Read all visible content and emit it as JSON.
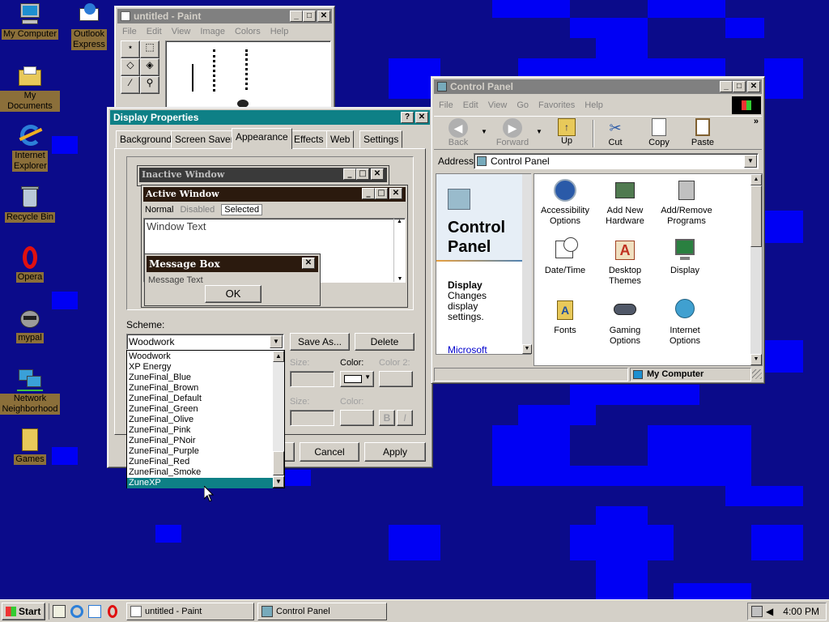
{
  "desktop": {
    "icons": [
      {
        "label": "My Computer"
      },
      {
        "label": "Outlook Express"
      },
      {
        "label": "My Documents"
      },
      {
        "label": "Internet Explorer"
      },
      {
        "label": "Recycle Bin"
      },
      {
        "label": "Opera"
      },
      {
        "label": "mypal"
      },
      {
        "label": "Network Neighborhood"
      },
      {
        "label": "Games"
      }
    ]
  },
  "paint": {
    "title": "untitled - Paint",
    "menu": [
      "File",
      "Edit",
      "View",
      "Image",
      "Colors",
      "Help"
    ]
  },
  "display_props": {
    "title": "Display Properties",
    "tabs": [
      "Background",
      "Screen Saver",
      "Appearance",
      "Effects",
      "Web",
      "Settings"
    ],
    "preview": {
      "inactive_title": "Inactive Window",
      "active_title": "Active Window",
      "menu_normal": "Normal",
      "menu_disabled": "Disabled",
      "menu_selected": "Selected",
      "window_text": "Window Text",
      "msgbox_title": "Message Box",
      "msgbox_text": "Message Text",
      "ok": "OK"
    },
    "scheme_label": "Scheme:",
    "scheme_value": "Woodwork",
    "save_as": "Save As...",
    "delete": "Delete",
    "size_label": "Size:",
    "color_label": "Color:",
    "color2_label": "Color 2:",
    "size2_label": "Size:",
    "color3_label": "Color:",
    "bold": "B",
    "italic": "I",
    "cancel": "Cancel",
    "apply": "Apply",
    "scheme_options": [
      "Woodwork",
      "XP Energy",
      "ZuneFinal_Blue",
      "ZuneFinal_Brown",
      "ZuneFinal_Default",
      "ZuneFinal_Green",
      "ZuneFinal_Olive",
      "ZuneFinal_Pink",
      "ZuneFinal_PNoir",
      "ZuneFinal_Purple",
      "ZuneFinal_Red",
      "ZuneFinal_Smoke",
      "ZuneXP"
    ],
    "selected_option": "ZuneXP"
  },
  "control_panel": {
    "title": "Control Panel",
    "menu": [
      "File",
      "Edit",
      "View",
      "Go",
      "Favorites",
      "Help"
    ],
    "toolbar": {
      "back": "Back",
      "forward": "Forward",
      "up": "Up",
      "cut": "Cut",
      "copy": "Copy",
      "paste": "Paste"
    },
    "address_label": "Address",
    "address_value": "Control Panel",
    "side_title": "Control Panel",
    "side_heading": "Display",
    "side_desc": "Changes display settings.",
    "side_link": "Microsoft",
    "items": [
      {
        "label": "Accessibility Options"
      },
      {
        "label": "Add New Hardware"
      },
      {
        "label": "Add/Remove Programs"
      },
      {
        "label": "Date/Time"
      },
      {
        "label": "Desktop Themes"
      },
      {
        "label": "Display"
      },
      {
        "label": "Fonts"
      },
      {
        "label": "Gaming Options"
      },
      {
        "label": "Internet Options"
      }
    ],
    "status": "My Computer"
  },
  "taskbar": {
    "start": "Start",
    "tasks": [
      "untitled - Paint",
      "Control Panel"
    ],
    "clock": "4:00 PM"
  },
  "colors": {
    "desktop": "#0b0b8a",
    "tiles": "#0000f4",
    "active_title": "#0e8086",
    "scheme_title": "#2b1a0e"
  }
}
